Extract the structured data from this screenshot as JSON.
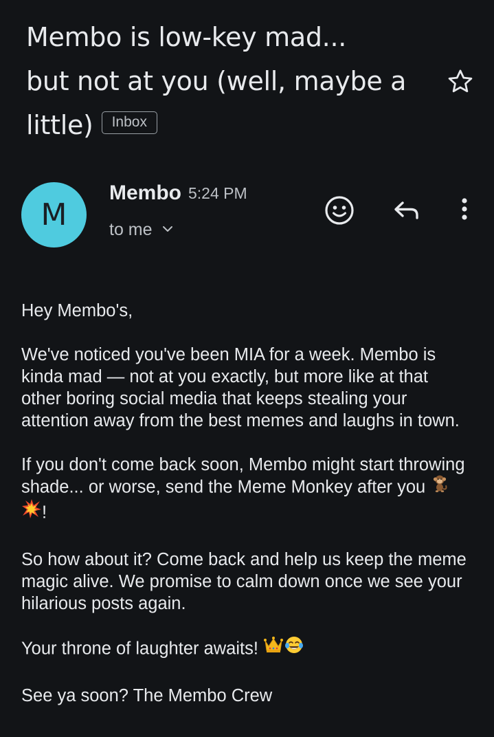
{
  "email": {
    "subject_lines": [
      "Membo is low-key mad...",
      "but not at you (well, maybe a",
      "little)"
    ],
    "label": "Inbox",
    "starred": false,
    "sender": {
      "initial": "M",
      "name": "Membo",
      "time": "5:24 PM",
      "recipient": "to me",
      "avatar_color": "#4fcbdf"
    },
    "actions": {
      "icons": [
        "emoji-reaction-icon",
        "reply-icon",
        "more-vert-icon"
      ]
    },
    "body": {
      "greeting": "Hey Membo's,",
      "paragraph1": "We've noticed you've been MIA for a week. Membo is kinda mad — not at you exactly, but more like at that other boring social media that keeps stealing your attention away from the best memes and laughs in town.",
      "paragraph2_text": "If you don't come back soon, Membo might start throwing shade... or worse, send the Meme Monkey after you ",
      "paragraph2_end": "!",
      "paragraph2_emojis": [
        "monkey-icon",
        "collision-icon"
      ],
      "paragraph3": "So how about it? Come back and help us keep the meme magic alive. We promise to calm down once we see your hilarious posts again.",
      "paragraph4_text": "Your throne of laughter awaits! ",
      "paragraph4_emojis": [
        "crown-icon",
        "tears-of-joy-icon"
      ],
      "signoff": "See ya soon? The Membo Crew"
    }
  },
  "colors": {
    "background": "#121417",
    "text": "#e8eaed",
    "secondary_text": "#bdc1c6",
    "avatar": "#4fcbdf"
  }
}
